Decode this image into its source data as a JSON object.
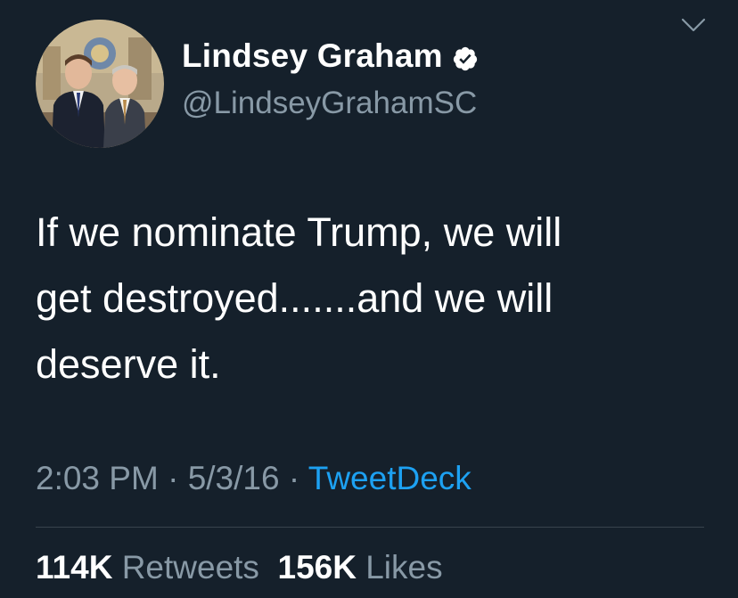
{
  "user": {
    "display_name": "Lindsey Graham",
    "handle": "@LindseyGrahamSC",
    "verified": true,
    "avatar_icon": "profile-photo"
  },
  "menu": {
    "icon": "chevron-down-icon"
  },
  "tweet": {
    "text_line_1": "If we nominate Trump, we will",
    "text_line_2": "get destroyed.......and we will",
    "text_line_3": "deserve it."
  },
  "meta": {
    "time": "2:03 PM",
    "date": "5/3/16",
    "separator": " · ",
    "source": "TweetDeck"
  },
  "stats": {
    "retweets_count": "114K",
    "retweets_label": "Retweets",
    "likes_count": "156K",
    "likes_label": "Likes"
  },
  "colors": {
    "background": "#15202b",
    "secondary_text": "#8899a6",
    "link": "#1da1f2",
    "divider": "#38444d"
  }
}
